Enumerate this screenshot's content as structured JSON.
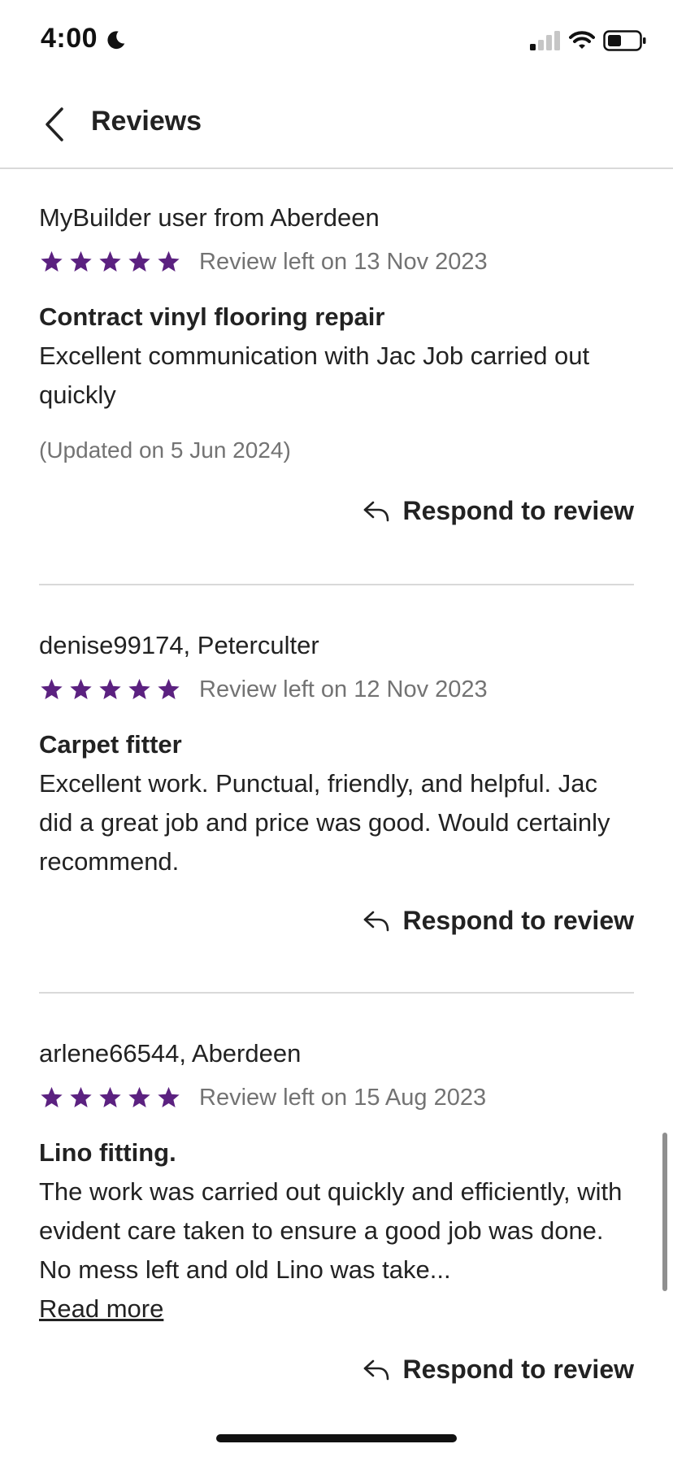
{
  "status_bar": {
    "time": "4:00"
  },
  "header": {
    "title": "Reviews"
  },
  "colors": {
    "star": "#5b2180",
    "divider": "#d9d9d9",
    "muted_text": "#737373"
  },
  "reviews": [
    {
      "reviewer": "MyBuilder user from Aberdeen",
      "rating": 5,
      "date": "Review left on 13 Nov 2023",
      "title": "Contract vinyl flooring repair",
      "body": "Excellent communication with Jac Job carried out quickly",
      "updated": "(Updated on 5 Jun 2024)",
      "respond_label": "Respond to review"
    },
    {
      "reviewer": "denise99174, Peterculter",
      "rating": 5,
      "date": "Review left on 12 Nov 2023",
      "title": "Carpet fitter",
      "body": "Excellent work. Punctual, friendly, and helpful. Jac did a great job and price was good. Would certainly recommend.",
      "respond_label": "Respond to review"
    },
    {
      "reviewer": "arlene66544, Aberdeen",
      "rating": 5,
      "date": "Review left on 15 Aug 2023",
      "title": "Lino fitting.",
      "body": "The work was carried out quickly and efficiently, with evident care taken to ensure a good job was done. No mess left and old Lino was take...",
      "read_more": "Read more",
      "respond_label": "Respond to review"
    }
  ]
}
